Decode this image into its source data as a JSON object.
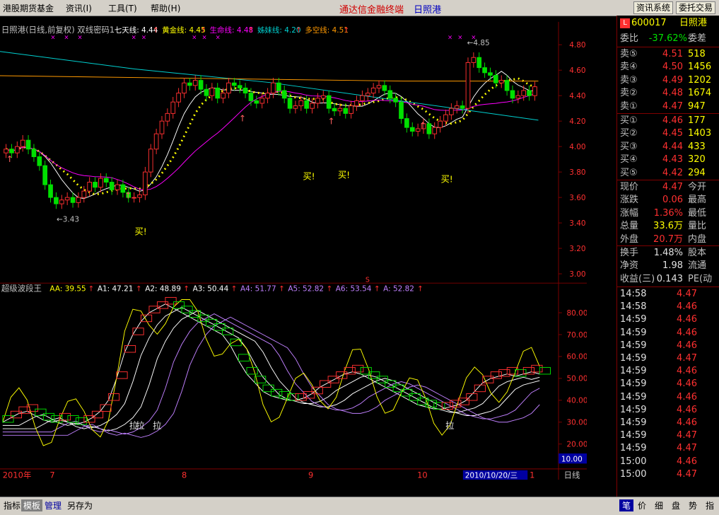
{
  "menu": {
    "items": [
      "港股期货基金",
      "资讯(I)",
      "工具(T)",
      "帮助(H)"
    ],
    "center_title": [
      "通达信金融终端",
      "日照港"
    ],
    "right_buttons": [
      "资讯系统",
      "委托交易"
    ]
  },
  "main_chart": {
    "header_label": "日照港(日线,前复权) 双线密码1",
    "indicators": [
      {
        "name": "七天线:",
        "value": "4.44",
        "color": "#ffffff"
      },
      {
        "name": "黄金线:",
        "value": "4.45",
        "color": "#ffff00"
      },
      {
        "name": "生命线:",
        "value": "4.48",
        "color": "#ff00ff"
      },
      {
        "name": "姊妹线:",
        "value": "4.20",
        "color": "#00d0d0"
      },
      {
        "name": "多空线:",
        "value": "4.51",
        "color": "#ff9900"
      }
    ],
    "price_axis": [
      "4.80",
      "4.60",
      "4.40",
      "4.20",
      "4.00",
      "3.80",
      "3.60",
      "3.40",
      "3.20",
      "3.00"
    ],
    "high_label": "4.85",
    "low_label": "3.43",
    "buy_labels": [
      "买!",
      "买!",
      "买!",
      "买!"
    ]
  },
  "sub_chart": {
    "header_label": "超级波段王",
    "indicators": [
      {
        "name": "AA:",
        "value": "39.55",
        "color": "#ffff00"
      },
      {
        "name": "A1:",
        "value": "47.21",
        "color": "#ffffff"
      },
      {
        "name": "A2:",
        "value": "48.89",
        "color": "#ffffff"
      },
      {
        "name": "A3:",
        "value": "50.44",
        "color": "#ffffff"
      },
      {
        "name": "A4:",
        "value": "51.77",
        "color": "#c080ff"
      },
      {
        "name": "A5:",
        "value": "52.82",
        "color": "#c080ff"
      },
      {
        "name": "A6:",
        "value": "53.54",
        "color": "#c080ff"
      },
      {
        "name": "A:",
        "value": "52.82",
        "color": "#c080ff"
      }
    ],
    "axis": [
      "80.00",
      "70.00",
      "60.00",
      "50.00",
      "40.00",
      "30.00",
      "20.00"
    ],
    "axis_box": "10.00",
    "pull_labels": [
      "拉",
      "拉",
      "拉",
      "拉"
    ],
    "marker_s": "S"
  },
  "timeline": {
    "labels": [
      "2010年",
      "7",
      "8",
      "9",
      "10",
      "1"
    ],
    "cursor_date": "2010/10/20/三",
    "period": "日线"
  },
  "quote": {
    "code": "600017",
    "name": "日照港",
    "badge": "L",
    "webi_label": "委比",
    "webi_value": "-37.62%",
    "wecha_label": "委差",
    "sell": [
      {
        "label": "卖⑤",
        "price": "4.51",
        "vol": "518"
      },
      {
        "label": "卖④",
        "price": "4.50",
        "vol": "1456"
      },
      {
        "label": "卖③",
        "price": "4.49",
        "vol": "1202"
      },
      {
        "label": "卖②",
        "price": "4.48",
        "vol": "1674"
      },
      {
        "label": "卖①",
        "price": "4.47",
        "vol": "947"
      }
    ],
    "buy": [
      {
        "label": "买①",
        "price": "4.46",
        "vol": "177"
      },
      {
        "label": "买②",
        "price": "4.45",
        "vol": "1403"
      },
      {
        "label": "买③",
        "price": "4.44",
        "vol": "433"
      },
      {
        "label": "买④",
        "price": "4.43",
        "vol": "320"
      },
      {
        "label": "买⑤",
        "price": "4.42",
        "vol": "294"
      }
    ],
    "stats": [
      {
        "label": "现价",
        "value": "4.47",
        "color": "#ff3030",
        "label2": "今开"
      },
      {
        "label": "涨跌",
        "value": "0.06",
        "color": "#ff3030",
        "label2": "最高"
      },
      {
        "label": "涨幅",
        "value": "1.36%",
        "color": "#ff3030",
        "label2": "最低"
      },
      {
        "label": "总量",
        "value": "33.6万",
        "color": "#ffff00",
        "label2": "量比"
      },
      {
        "label": "外盘",
        "value": "20.7万",
        "color": "#ff3030",
        "label2": "内盘"
      }
    ],
    "stats2": [
      {
        "label": "换手",
        "value": "1.48%",
        "color": "#e0e0e0",
        "label2": "股本"
      },
      {
        "label": "净资",
        "value": "1.98",
        "color": "#e0e0e0",
        "label2": "流通"
      },
      {
        "label": "收益(三)",
        "value": "0.143",
        "color": "#e0e0e0",
        "label2": "PE(动"
      }
    ],
    "ticks": [
      {
        "time": "14:58",
        "price": "4.47",
        "color": "#ff3030"
      },
      {
        "time": "14:58",
        "price": "4.46",
        "color": "#ff3030"
      },
      {
        "time": "14:59",
        "price": "4.46",
        "color": "#ff3030"
      },
      {
        "time": "14:59",
        "price": "4.46",
        "color": "#ff3030"
      },
      {
        "time": "14:59",
        "price": "4.46",
        "color": "#ff3030"
      },
      {
        "time": "14:59",
        "price": "4.47",
        "color": "#ff3030"
      },
      {
        "time": "14:59",
        "price": "4.46",
        "color": "#ff3030"
      },
      {
        "time": "14:59",
        "price": "4.46",
        "color": "#ff3030"
      },
      {
        "time": "14:59",
        "price": "4.46",
        "color": "#ff3030"
      },
      {
        "time": "14:59",
        "price": "4.46",
        "color": "#ff3030"
      },
      {
        "time": "14:59",
        "price": "4.46",
        "color": "#ff3030"
      },
      {
        "time": "14:59",
        "price": "4.47",
        "color": "#ff3030"
      },
      {
        "time": "14:59",
        "price": "4.47",
        "color": "#ff3030"
      },
      {
        "time": "15:00",
        "price": "4.46",
        "color": "#ff3030"
      },
      {
        "time": "15:00",
        "price": "4.47",
        "color": "#ff3030"
      }
    ]
  },
  "bottom_tabs": [
    "指标",
    "模板",
    "管理",
    "另存为"
  ],
  "right_tabs": [
    "笔",
    "价",
    "细",
    "盘",
    "势",
    "指"
  ],
  "colors": {
    "up": "#ff3030",
    "down": "#00e000",
    "bg": "#000000",
    "border": "#800000"
  }
}
